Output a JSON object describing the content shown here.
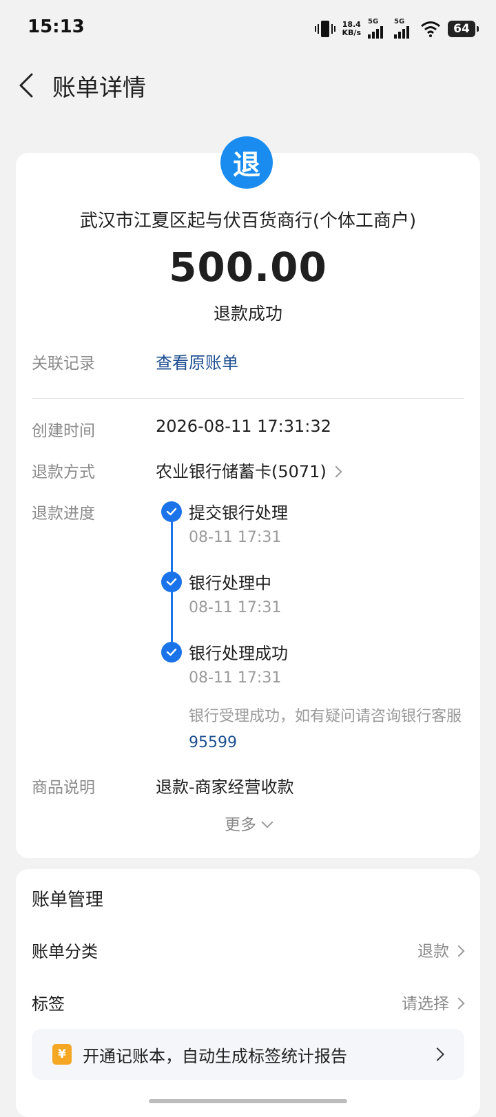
{
  "status_bar": {
    "time": "15:13",
    "net_speed_value": "18.4",
    "net_speed_unit": "KB/s",
    "signal1_label": "5G",
    "signal2_label": "5G",
    "battery": "64"
  },
  "header": {
    "title": "账单详情"
  },
  "bill": {
    "icon_char": "退",
    "merchant": "武汉市江夏区起与伏百货商行(个体工商户)",
    "amount": "500.00",
    "status": "退款成功",
    "related_label": "关联记录",
    "related_value": "查看原账单",
    "created_label": "创建时间",
    "created_value": "2026-08-11 17:31:32",
    "method_label": "退款方式",
    "method_value": "农业银行储蓄卡(5071)",
    "progress_label": "退款进度",
    "progress": [
      {
        "title": "提交银行处理",
        "time": "08-11 17:31"
      },
      {
        "title": "银行处理中",
        "time": "08-11 17:31"
      },
      {
        "title": "银行处理成功",
        "time": "08-11 17:31"
      }
    ],
    "note_text": "银行受理成功，如有疑问请咨询银行客服",
    "note_phone": "95599",
    "goods_label": "商品说明",
    "goods_value": "退款-商家经营收款",
    "more_label": "更多"
  },
  "manage": {
    "title": "账单管理",
    "category_label": "账单分类",
    "category_value": "退款",
    "tag_label": "标签",
    "tag_value": "请选择",
    "promo_icon": "¥",
    "promo_text": "开通记账本，自动生成标签统计报告"
  },
  "colors": {
    "accent": "#1a8cf0",
    "timeline": "#1a73e8",
    "link": "#1d4f91",
    "promo_icon": "#f5a623"
  }
}
